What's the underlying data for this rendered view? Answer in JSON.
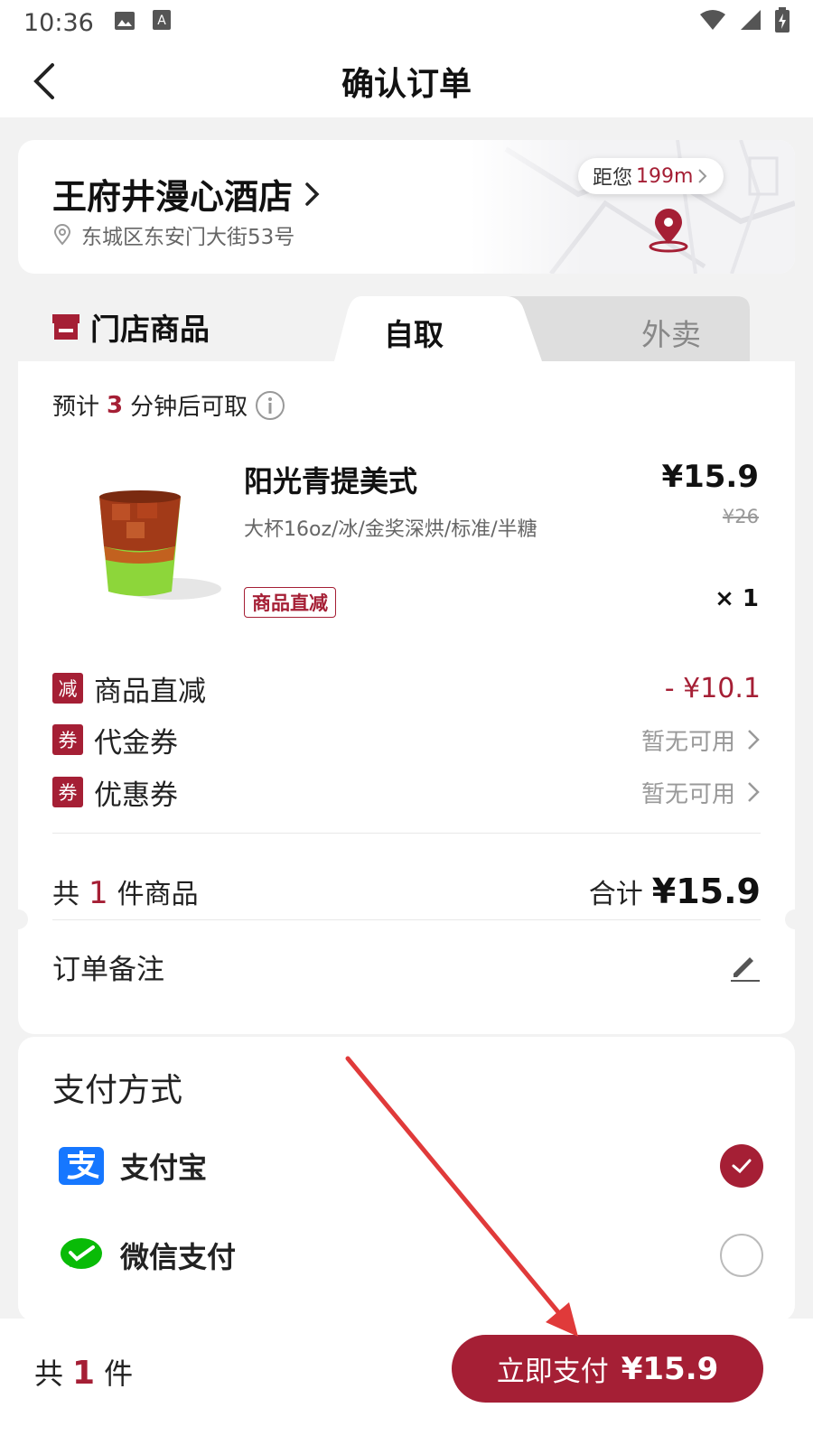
{
  "status_bar": {
    "time": "10:36"
  },
  "header": {
    "title": "确认订单"
  },
  "store": {
    "name": "王府井漫心酒店",
    "address": "东城区东安门大街53号",
    "distance_prefix": "距您",
    "distance_value": "199m"
  },
  "tabs": {
    "store_goods": "门店商品",
    "pickup": "自取",
    "delivery": "外卖"
  },
  "order": {
    "eta_prefix": "预计",
    "eta_minutes": "3",
    "eta_suffix": "分钟后可取",
    "product": {
      "name": "阳光青提美式",
      "spec": "大杯16oz/冰/金奖深烘/标准/半糖",
      "tag": "商品直减",
      "price": "¥15.9",
      "original_price": "¥26",
      "quantity": "× 1"
    },
    "discount": {
      "badge": "减",
      "label": "商品直减",
      "value": "- ¥10.1"
    },
    "voucher": {
      "badge": "券",
      "label": "代金券",
      "value": "暂无可用"
    },
    "coupon": {
      "badge": "券",
      "label": "优惠券",
      "value": "暂无可用"
    },
    "total": {
      "prefix": "共",
      "count": "1",
      "suffix": "件商品",
      "label": "合计",
      "value": "¥15.9"
    },
    "remark_label": "订单备注"
  },
  "payment": {
    "title": "支付方式",
    "methods": [
      {
        "name": "支付宝",
        "icon": "alipay-icon",
        "selected": true
      },
      {
        "name": "微信支付",
        "icon": "wechat-pay-icon",
        "selected": false
      }
    ]
  },
  "bottom": {
    "count_prefix": "共",
    "count": "1",
    "count_suffix": "件",
    "pay_label": "立即支付",
    "pay_amount": "¥15.9"
  },
  "colors": {
    "brand": "#a51f35",
    "alipay": "#1677ff",
    "wechat": "#09bb07",
    "annotation_arrow": "#e03a3a"
  }
}
